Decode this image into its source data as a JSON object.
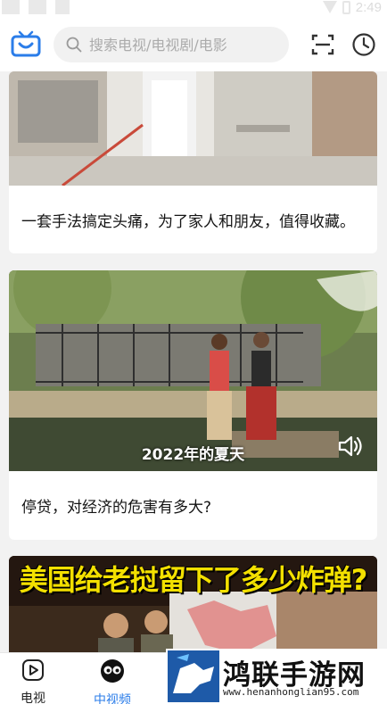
{
  "status_bar": {
    "time": "2:49"
  },
  "search": {
    "placeholder": "搜索电视/电视剧/电影"
  },
  "icons": {
    "logo": "tv-logo-icon",
    "scan": "scan-icon",
    "history": "clock-icon",
    "search": "search-icon",
    "sound": "volume-icon"
  },
  "feed": {
    "cards": [
      {
        "title": "一套手法搞定头痛，为了家人和朋友，值得收藏。"
      },
      {
        "title": "停贷，对经济的危害有多大?",
        "video_caption": "2022年的夏天"
      },
      {
        "banner_text": "美国给老挝留下了多少炸弹?"
      }
    ]
  },
  "bottom_nav": {
    "items": [
      {
        "label": "电视",
        "active": false
      },
      {
        "label": "中视频",
        "active": true
      }
    ]
  },
  "watermark": {
    "text": "鸿联手游网",
    "url": "www.henanhonglian95.com"
  },
  "colors": {
    "accent": "#2b7de9",
    "active_nav": "#2b7de9",
    "banner_text": "#f3e000"
  }
}
